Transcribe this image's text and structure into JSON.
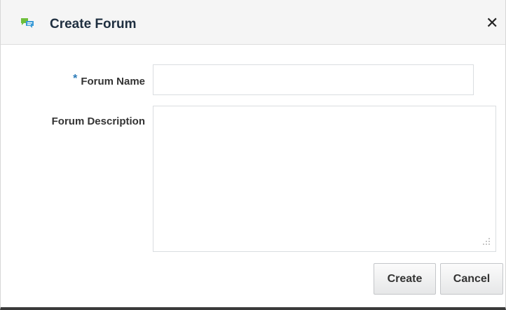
{
  "dialog": {
    "title": "Create Forum",
    "close_glyph": "✕",
    "icon": "forum-speech-bubbles-icon"
  },
  "form": {
    "name_required_marker": "*",
    "name_label": "Forum Name",
    "name_value": "",
    "description_label": "Forum Description",
    "description_value": ""
  },
  "buttons": {
    "create_label": "Create",
    "cancel_label": "Cancel"
  },
  "colors": {
    "header_background": "#f5f5f5",
    "title_text": "#1f2f40",
    "required_marker": "#2a7ab8",
    "icon_green": "#6fbf3b",
    "icon_blue": "#3b9bd7"
  }
}
